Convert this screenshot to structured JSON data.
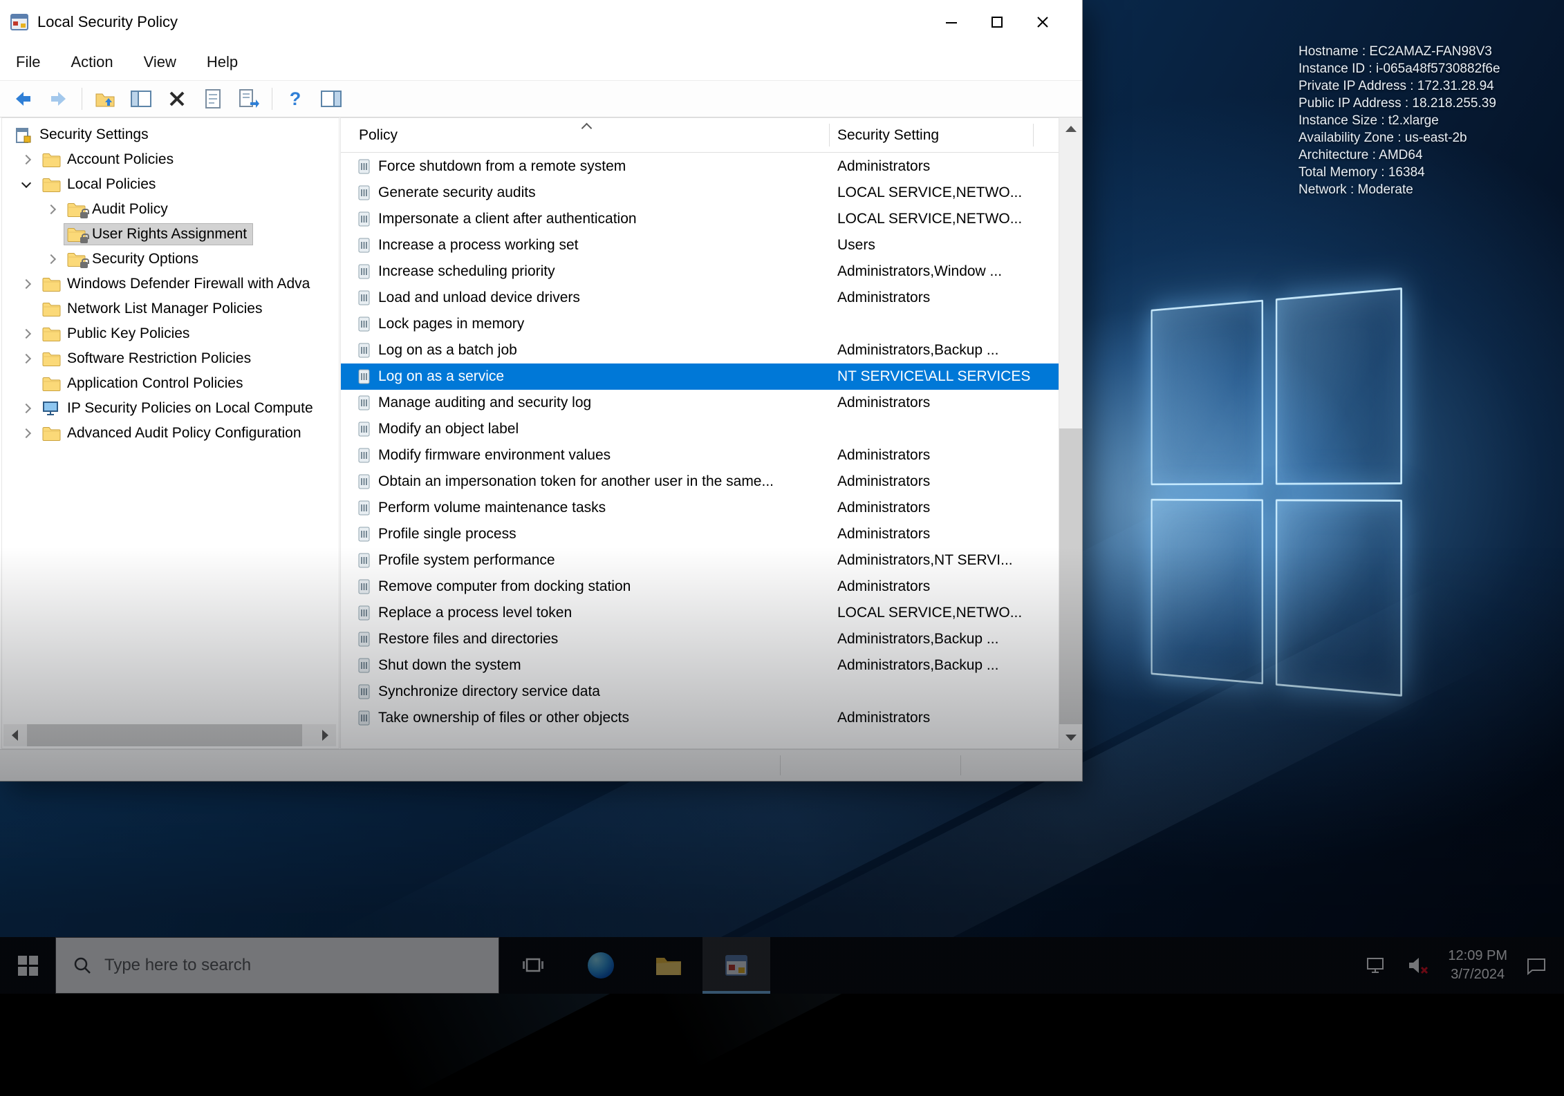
{
  "colors": {
    "selection_blue": "#0078d7",
    "taskbar_black": "#0a0a0a",
    "desktop_blue": "#0d3a66"
  },
  "window": {
    "title": "Local Security Policy",
    "menu": [
      "File",
      "Action",
      "View",
      "Help"
    ],
    "toolbar_icons": [
      "back",
      "forward",
      "up",
      "show-console-tree",
      "delete",
      "properties",
      "export-list",
      "help",
      "action-pane"
    ],
    "tree": {
      "items": [
        {
          "label": "Security Settings",
          "level": 0,
          "icon": "root",
          "expander": "none",
          "selected": false
        },
        {
          "label": "Account Policies",
          "level": 1,
          "icon": "folder",
          "expander": "collapsed",
          "selected": false
        },
        {
          "label": "Local Policies",
          "level": 1,
          "icon": "folder",
          "expander": "expanded",
          "selected": false
        },
        {
          "label": "Audit Policy",
          "level": 2,
          "icon": "folder-lock",
          "expander": "collapsed",
          "selected": false
        },
        {
          "label": "User Rights Assignment",
          "level": 2,
          "icon": "folder-lock",
          "expander": "none",
          "selected": true
        },
        {
          "label": "Security Options",
          "level": 2,
          "icon": "folder-lock",
          "expander": "collapsed",
          "selected": false
        },
        {
          "label": "Windows Defender Firewall with Adva",
          "level": 1,
          "icon": "folder",
          "expander": "collapsed",
          "selected": false
        },
        {
          "label": "Network List Manager Policies",
          "level": 1,
          "icon": "folder",
          "expander": "none",
          "selected": false
        },
        {
          "label": "Public Key Policies",
          "level": 1,
          "icon": "folder",
          "expander": "collapsed",
          "selected": false
        },
        {
          "label": "Software Restriction Policies",
          "level": 1,
          "icon": "folder",
          "expander": "collapsed",
          "selected": false
        },
        {
          "label": "Application Control Policies",
          "level": 1,
          "icon": "folder",
          "expander": "none",
          "selected": false
        },
        {
          "label": "IP Security Policies on Local Compute",
          "level": 1,
          "icon": "computer",
          "expander": "collapsed",
          "selected": false
        },
        {
          "label": "Advanced Audit Policy Configuration",
          "level": 1,
          "icon": "folder",
          "expander": "collapsed",
          "selected": false
        }
      ]
    },
    "list": {
      "columns": [
        "Policy",
        "Security Setting"
      ],
      "rows": [
        {
          "policy": "Force shutdown from a remote system",
          "setting": "Administrators",
          "selected": false
        },
        {
          "policy": "Generate security audits",
          "setting": "LOCAL SERVICE,NETWO...",
          "selected": false
        },
        {
          "policy": "Impersonate a client after authentication",
          "setting": "LOCAL SERVICE,NETWO...",
          "selected": false
        },
        {
          "policy": "Increase a process working set",
          "setting": "Users",
          "selected": false
        },
        {
          "policy": "Increase scheduling priority",
          "setting": "Administrators,Window ...",
          "selected": false
        },
        {
          "policy": "Load and unload device drivers",
          "setting": "Administrators",
          "selected": false
        },
        {
          "policy": "Lock pages in memory",
          "setting": "",
          "selected": false
        },
        {
          "policy": "Log on as a batch job",
          "setting": "Administrators,Backup ...",
          "selected": false
        },
        {
          "policy": "Log on as a service",
          "setting": "NT SERVICE\\ALL SERVICES",
          "selected": true
        },
        {
          "policy": "Manage auditing and security log",
          "setting": "Administrators",
          "selected": false
        },
        {
          "policy": "Modify an object label",
          "setting": "",
          "selected": false
        },
        {
          "policy": "Modify firmware environment values",
          "setting": "Administrators",
          "selected": false
        },
        {
          "policy": "Obtain an impersonation token for another user in the same...",
          "setting": "Administrators",
          "selected": false
        },
        {
          "policy": "Perform volume maintenance tasks",
          "setting": "Administrators",
          "selected": false
        },
        {
          "policy": "Profile single process",
          "setting": "Administrators",
          "selected": false
        },
        {
          "policy": "Profile system performance",
          "setting": "Administrators,NT SERVI...",
          "selected": false
        },
        {
          "policy": "Remove computer from docking station",
          "setting": "Administrators",
          "selected": false
        },
        {
          "policy": "Replace a process level token",
          "setting": "LOCAL SERVICE,NETWO...",
          "selected": false
        },
        {
          "policy": "Restore files and directories",
          "setting": "Administrators,Backup ...",
          "selected": false
        },
        {
          "policy": "Shut down the system",
          "setting": "Administrators,Backup ...",
          "selected": false
        },
        {
          "policy": "Synchronize directory service data",
          "setting": "",
          "selected": false
        },
        {
          "policy": "Take ownership of files or other objects",
          "setting": "Administrators",
          "selected": false
        }
      ]
    }
  },
  "desktop": {
    "system_info": [
      "Hostname : EC2AMAZ-FAN98V3",
      "Instance ID : i-065a48f5730882f6e",
      "Private IP Address : 172.31.28.94",
      "Public IP Address : 18.218.255.39",
      "Instance Size : t2.xlarge",
      "Availability Zone : us-east-2b",
      "Architecture : AMD64",
      "Total Memory : 16384",
      "Network : Moderate"
    ]
  },
  "taskbar": {
    "search_placeholder": "Type here to search",
    "clock": {
      "time": "12:09 PM",
      "date": "3/7/2024"
    }
  }
}
